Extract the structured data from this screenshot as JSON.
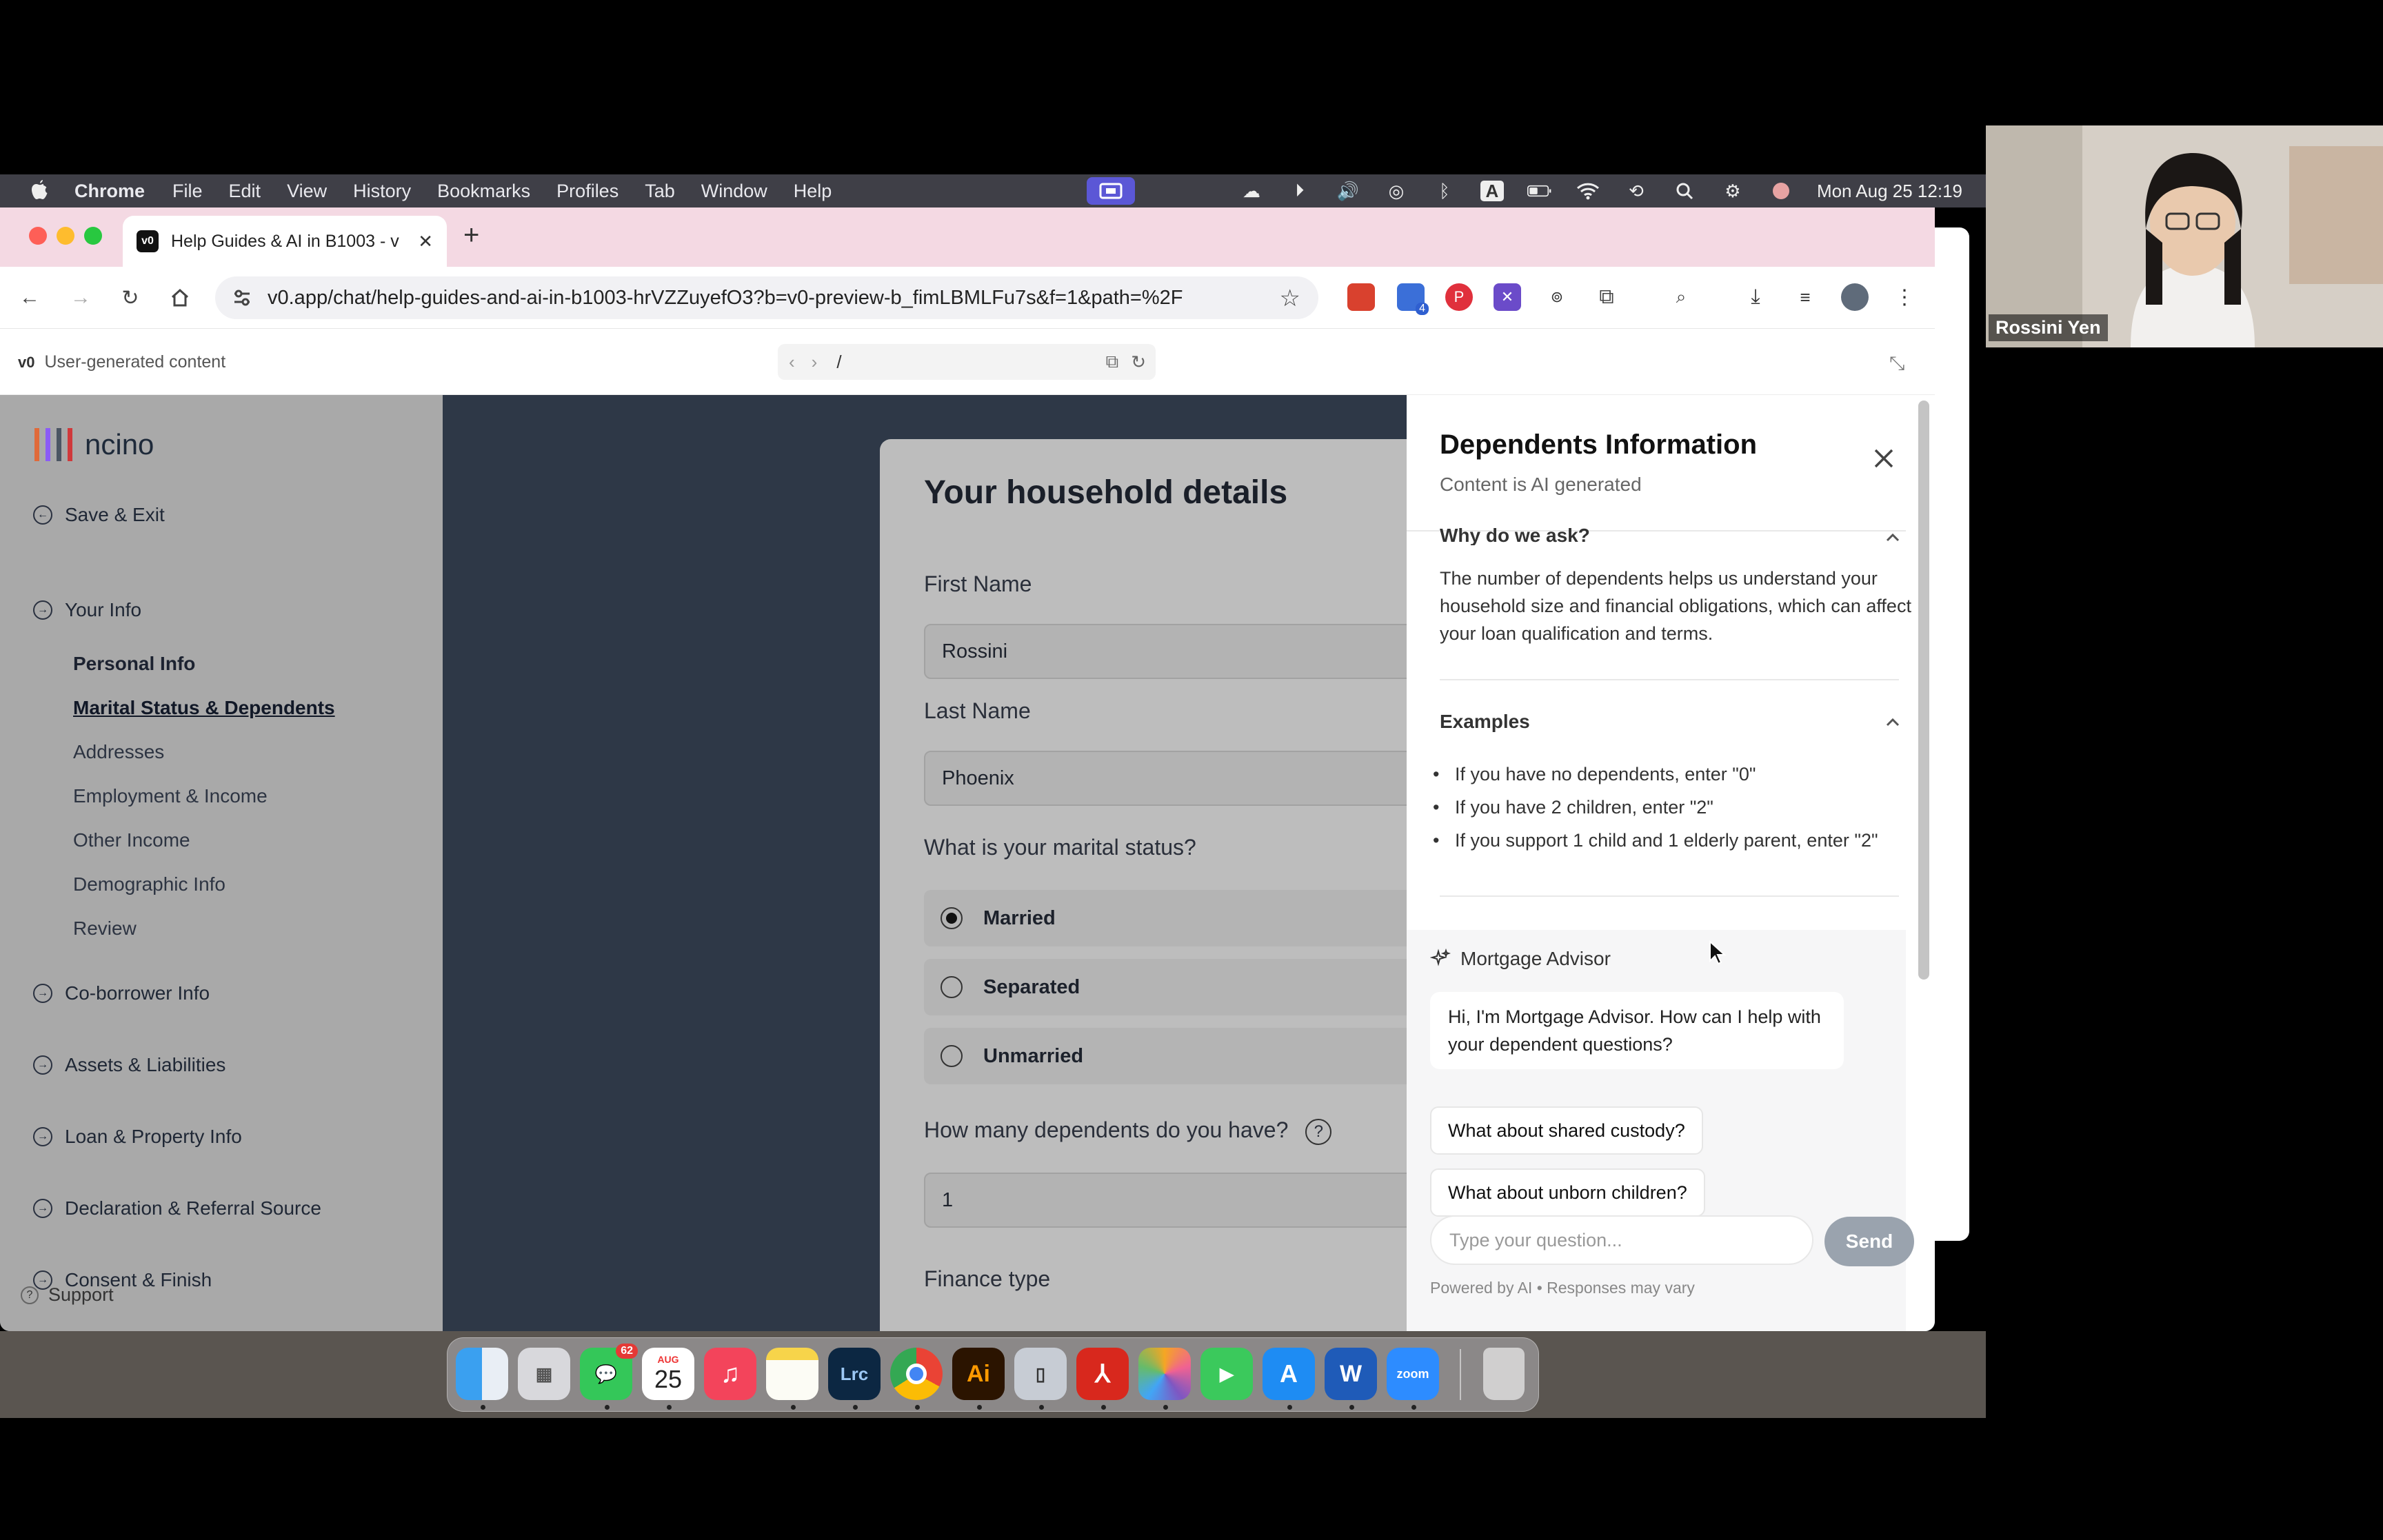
{
  "menubar": {
    "app": "Chrome",
    "items": [
      "File",
      "Edit",
      "View",
      "History",
      "Bookmarks",
      "Profiles",
      "Tab",
      "Window",
      "Help"
    ],
    "clock": "Mon Aug 25  12:19"
  },
  "browser": {
    "tab_title": "Help Guides & AI in B1003 - v",
    "url": "v0.app/chat/help-guides-and-ai-in-b1003-hrVZZuyefO3?b=v0-preview-b_fimLBMLFu7s&f=1&path=%2F",
    "extension_badge": "4"
  },
  "preview": {
    "label": "User-generated content",
    "path": "/"
  },
  "sidebar": {
    "logo": "ncino",
    "logo_colors": [
      "#e06a3a",
      "#8b5cf6",
      "#4b5563",
      "#d0393b"
    ],
    "save_exit": "Save & Exit",
    "your_info": "Your Info",
    "sub_items": [
      "Personal Info",
      "Marital Status & Dependents",
      "Addresses",
      "Employment & Income",
      "Other Income",
      "Demographic Info",
      "Review"
    ],
    "sections": [
      "Co-borrower Info",
      "Assets & Liabilities",
      "Loan & Property Info",
      "Declaration & Referral Source",
      "Consent & Finish"
    ],
    "support": "Support"
  },
  "form": {
    "title": "Your household details",
    "first_name_label": "First Name",
    "first_name_value": "Rossini",
    "last_name_label": "Last Name",
    "last_name_value": "Phoenix",
    "marital_label": "What is your marital status?",
    "marital_options": [
      "Married",
      "Separated",
      "Unmarried"
    ],
    "marital_selected": "Married",
    "dependents_label": "How many dependents do you have?",
    "dependents_value": "1",
    "finance_label": "Finance type"
  },
  "panel": {
    "title": "Dependents Information",
    "subtitle": "Content is AI generated",
    "why_heading": "Why do we ask?",
    "why_text": "The number of dependents helps us understand your household size and financial obligations, which can affect your loan qualification and terms.",
    "examples_heading": "Examples",
    "examples": [
      "If you have no dependents, enter \"0\"",
      "If you have 2 children, enter \"2\"",
      "If you support 1 child and 1 elderly parent, enter \"2\""
    ],
    "advisor_title": "Mortgage Advisor",
    "advisor_greeting": "Hi, I'm Mortgage Advisor. How can I help with your dependent questions?",
    "suggestions": [
      "What about shared custody?",
      "What about unborn children?"
    ],
    "input_placeholder": "Type your question...",
    "send_label": "Send",
    "footer": "Powered by AI • Responses may vary"
  },
  "dock": {
    "messages_badge": "62",
    "calendar_month": "AUG",
    "calendar_day": "25",
    "lrc": "Lrc",
    "ai": "Ai",
    "zoom": "zoom"
  },
  "webcam": {
    "name": "Rossini Yen"
  }
}
